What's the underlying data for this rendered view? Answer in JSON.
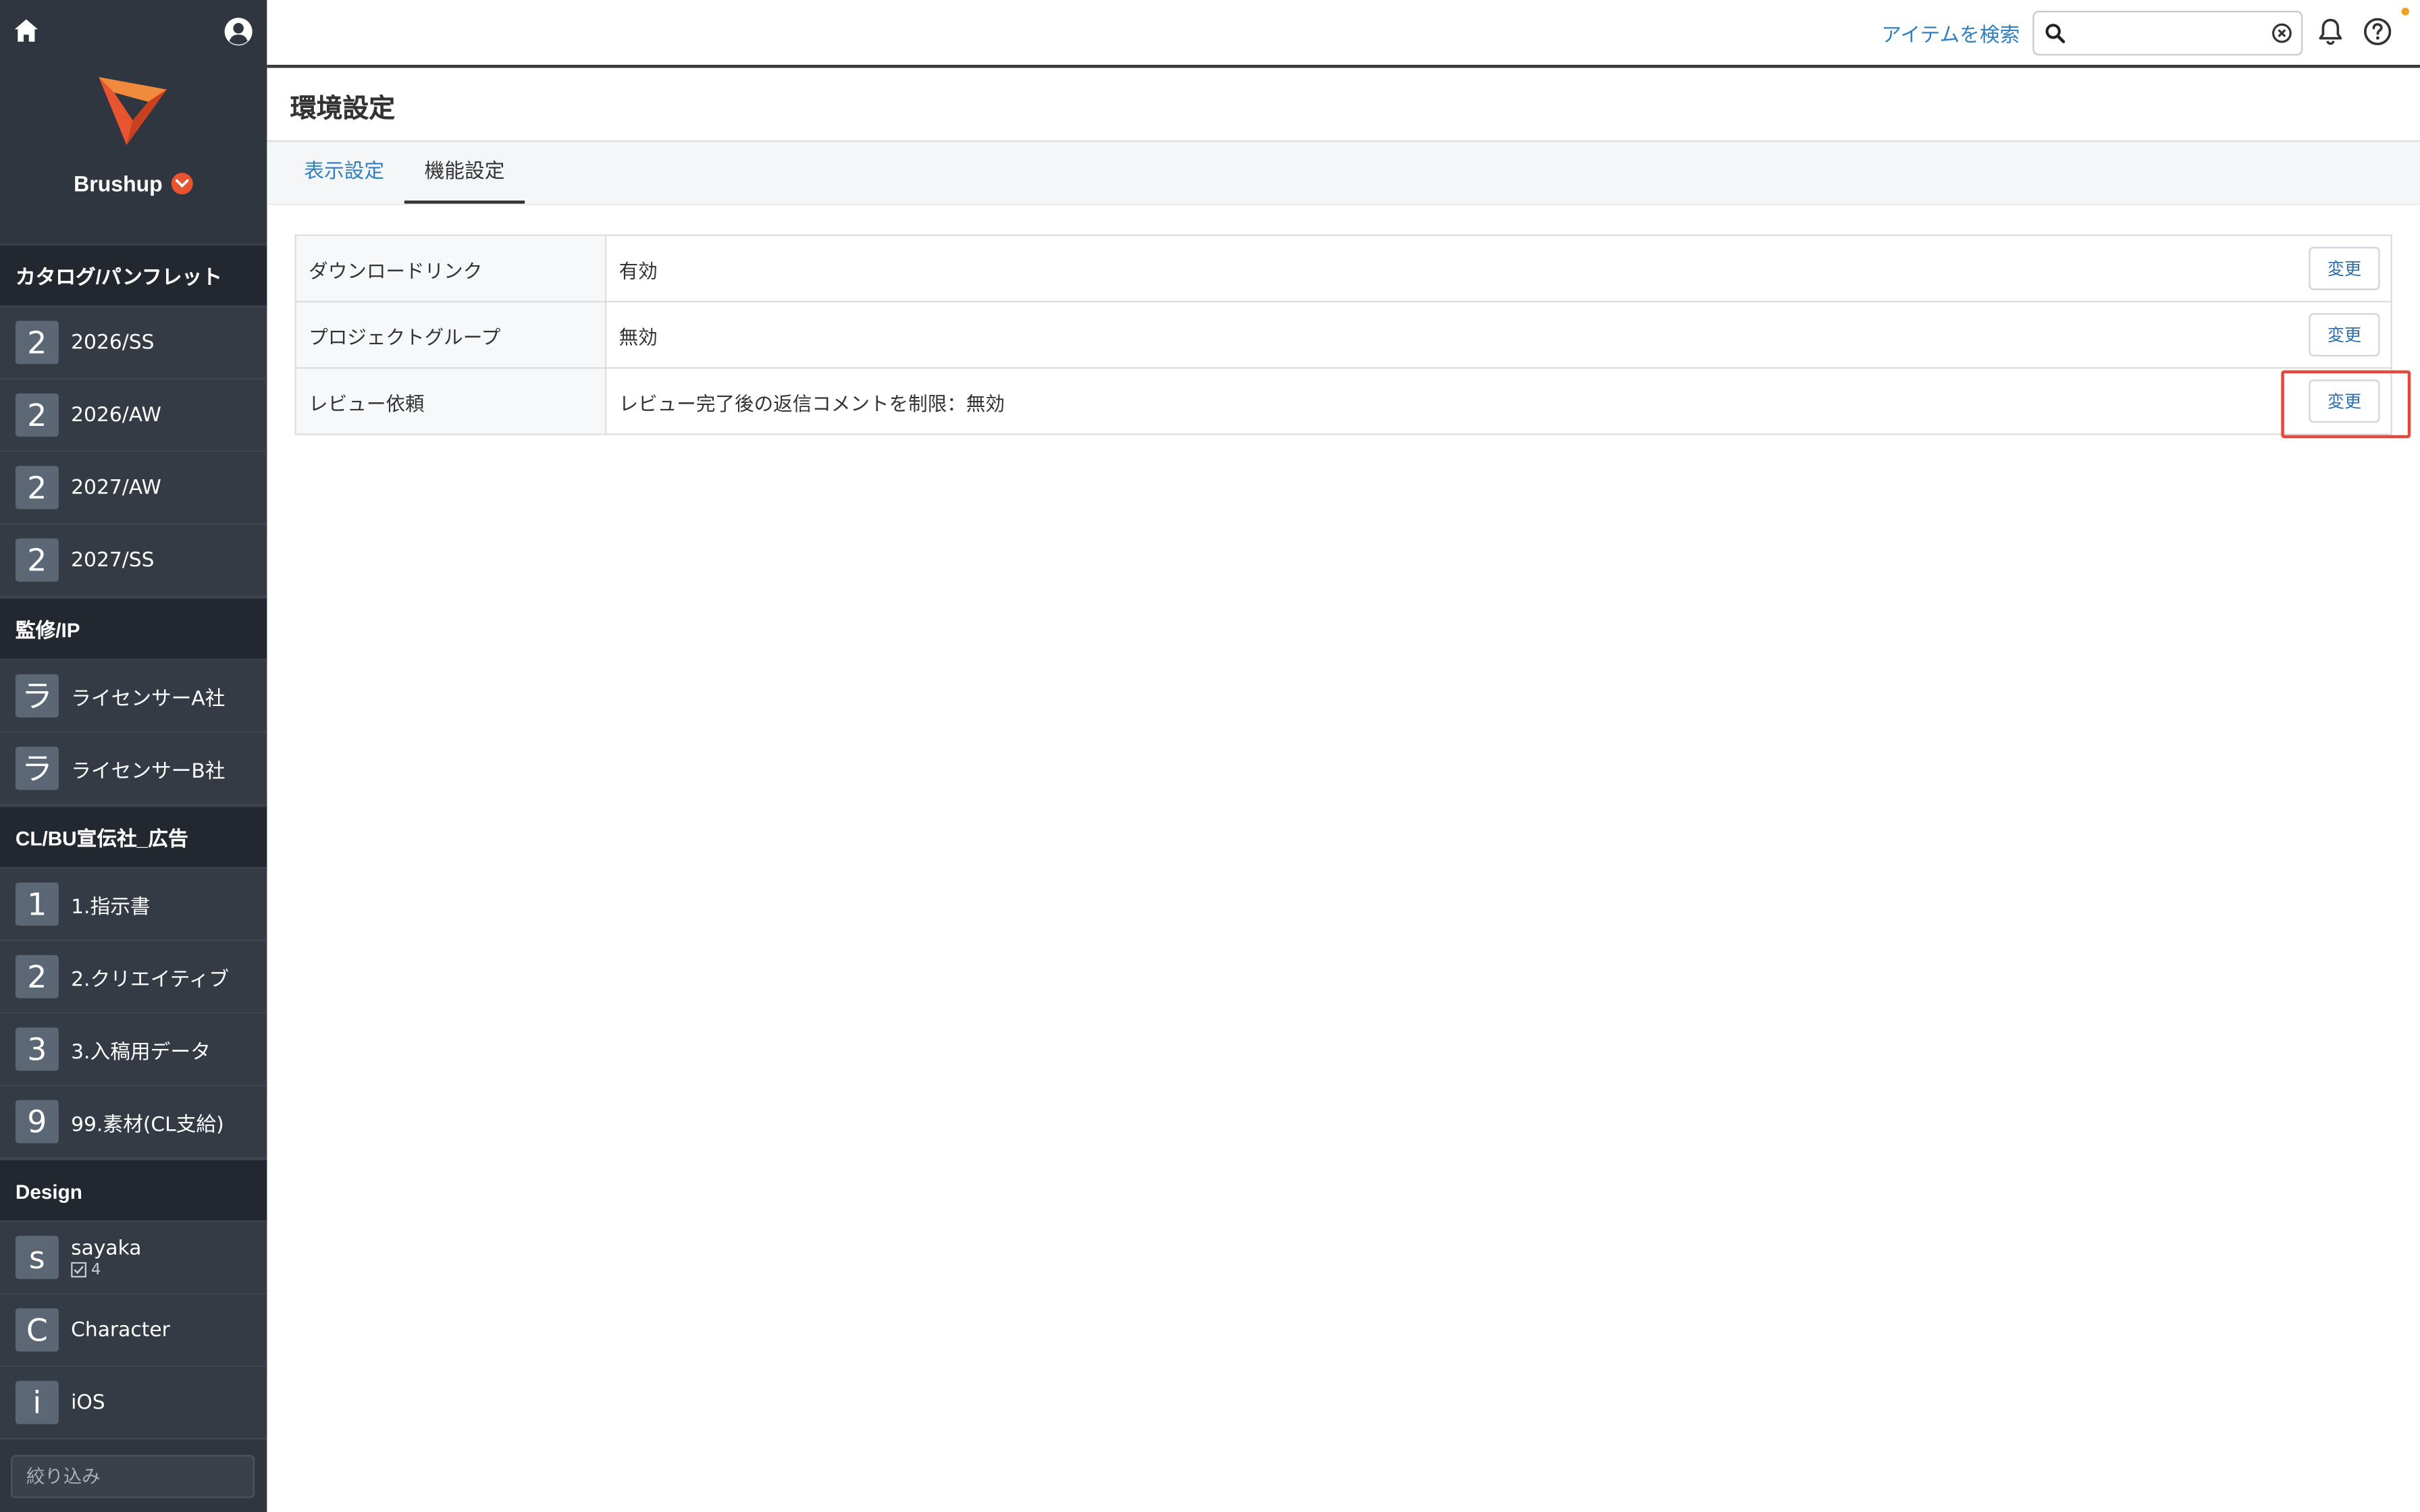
{
  "sidebar": {
    "workspace_name": "Brushup",
    "filter_placeholder": "絞り込み",
    "sections": [
      {
        "header": "カタログ/パンフレット",
        "items": [
          {
            "badge": "2",
            "label": "2026/SS"
          },
          {
            "badge": "2",
            "label": "2026/AW"
          },
          {
            "badge": "2",
            "label": "2027/AW"
          },
          {
            "badge": "2",
            "label": "2027/SS"
          }
        ]
      },
      {
        "header": "監修/IP",
        "items": [
          {
            "badge": "ラ",
            "label": "ライセンサーA社"
          },
          {
            "badge": "ラ",
            "label": "ライセンサーB社"
          }
        ]
      },
      {
        "header": "CL/BU宣伝社_広告",
        "items": [
          {
            "badge": "1",
            "label": "1.指示書"
          },
          {
            "badge": "2",
            "label": "2.クリエイティブ"
          },
          {
            "badge": "3",
            "label": "3.入稿用データ"
          },
          {
            "badge": "9",
            "label": "99.素材(CL支給)"
          }
        ]
      },
      {
        "header": "Design",
        "items": [
          {
            "badge": "s",
            "label": "sayaka",
            "sub_count": "4"
          },
          {
            "badge": "C",
            "label": "Character"
          },
          {
            "badge": "i",
            "label": "iOS"
          }
        ]
      }
    ]
  },
  "topbar": {
    "search_link": "アイテムを検索",
    "search_value": "",
    "accent_color": "#2f80c2",
    "notify_color": "#f0a020"
  },
  "page": {
    "title": "環境設定",
    "tabs": [
      {
        "label": "表示設定",
        "active": false
      },
      {
        "label": "機能設定",
        "active": true
      }
    ]
  },
  "settings": {
    "rows": [
      {
        "label": "ダウンロードリンク",
        "value": "有効",
        "button": "変更"
      },
      {
        "label": "プロジェクトグループ",
        "value": "無効",
        "button": "変更"
      },
      {
        "label": "レビュー依頼",
        "value": "レビュー完了後の返信コメントを制限：無効",
        "button": "変更"
      }
    ]
  },
  "highlight_color": "#e24b3b"
}
